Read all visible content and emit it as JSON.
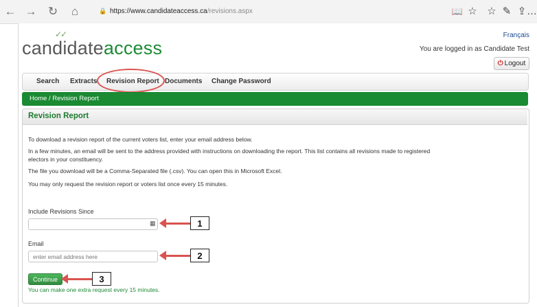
{
  "browser": {
    "url_host": "https://www.candidateaccess.ca",
    "url_path": "/revisions.aspx",
    "back_icon": "←",
    "forward_icon": "→",
    "refresh_icon": "↻",
    "home_icon": "⌂",
    "lock_icon": "🔒",
    "reading_icon": "📖",
    "favorite_icon": "☆",
    "favorites_bar_icon": "☆",
    "pen_icon": "✎",
    "share_icon": "⇪",
    "more_icon": "…"
  },
  "header": {
    "logo_part1": "candidate",
    "logo_part2": "access",
    "checkmarks": "✓✓",
    "language_link": "Français",
    "logged_in_text": "You are logged in as Candidate Test",
    "logout_icon": "⏻",
    "logout_label": "Logout"
  },
  "menu": {
    "items": [
      {
        "label": "Search"
      },
      {
        "label": "Extracts"
      },
      {
        "label": "Revision Report"
      },
      {
        "label": "Documents"
      },
      {
        "label": "Change Password"
      }
    ]
  },
  "breadcrumb": "Home / Revision Report",
  "panel": {
    "title": "Revision Report",
    "paragraphs": [
      "To download a revision report of the current voters list, enter your email address below.",
      "In a few minutes, an email will be sent to the address provided with instructions on downloading the report. This list contains all revisions made to registered electors in your constituency.",
      "The file you download will be a Comma-Separated file (.csv). You can open this in Microsoft Excel.",
      "You may only request the revision report or voters list once every 15 minutes."
    ],
    "since_label": "Include Revisions Since",
    "since_value": "",
    "calendar_icon": "▦",
    "email_label": "Email",
    "email_value": "",
    "email_placeholder": "enter email address here",
    "continue_label": "Continue",
    "note": "You can make one extra request every 15 minutes."
  },
  "callouts": [
    "1",
    "2",
    "3"
  ],
  "colors": {
    "brand_green": "#1a8a33",
    "annotation_red": "#d9534f"
  }
}
